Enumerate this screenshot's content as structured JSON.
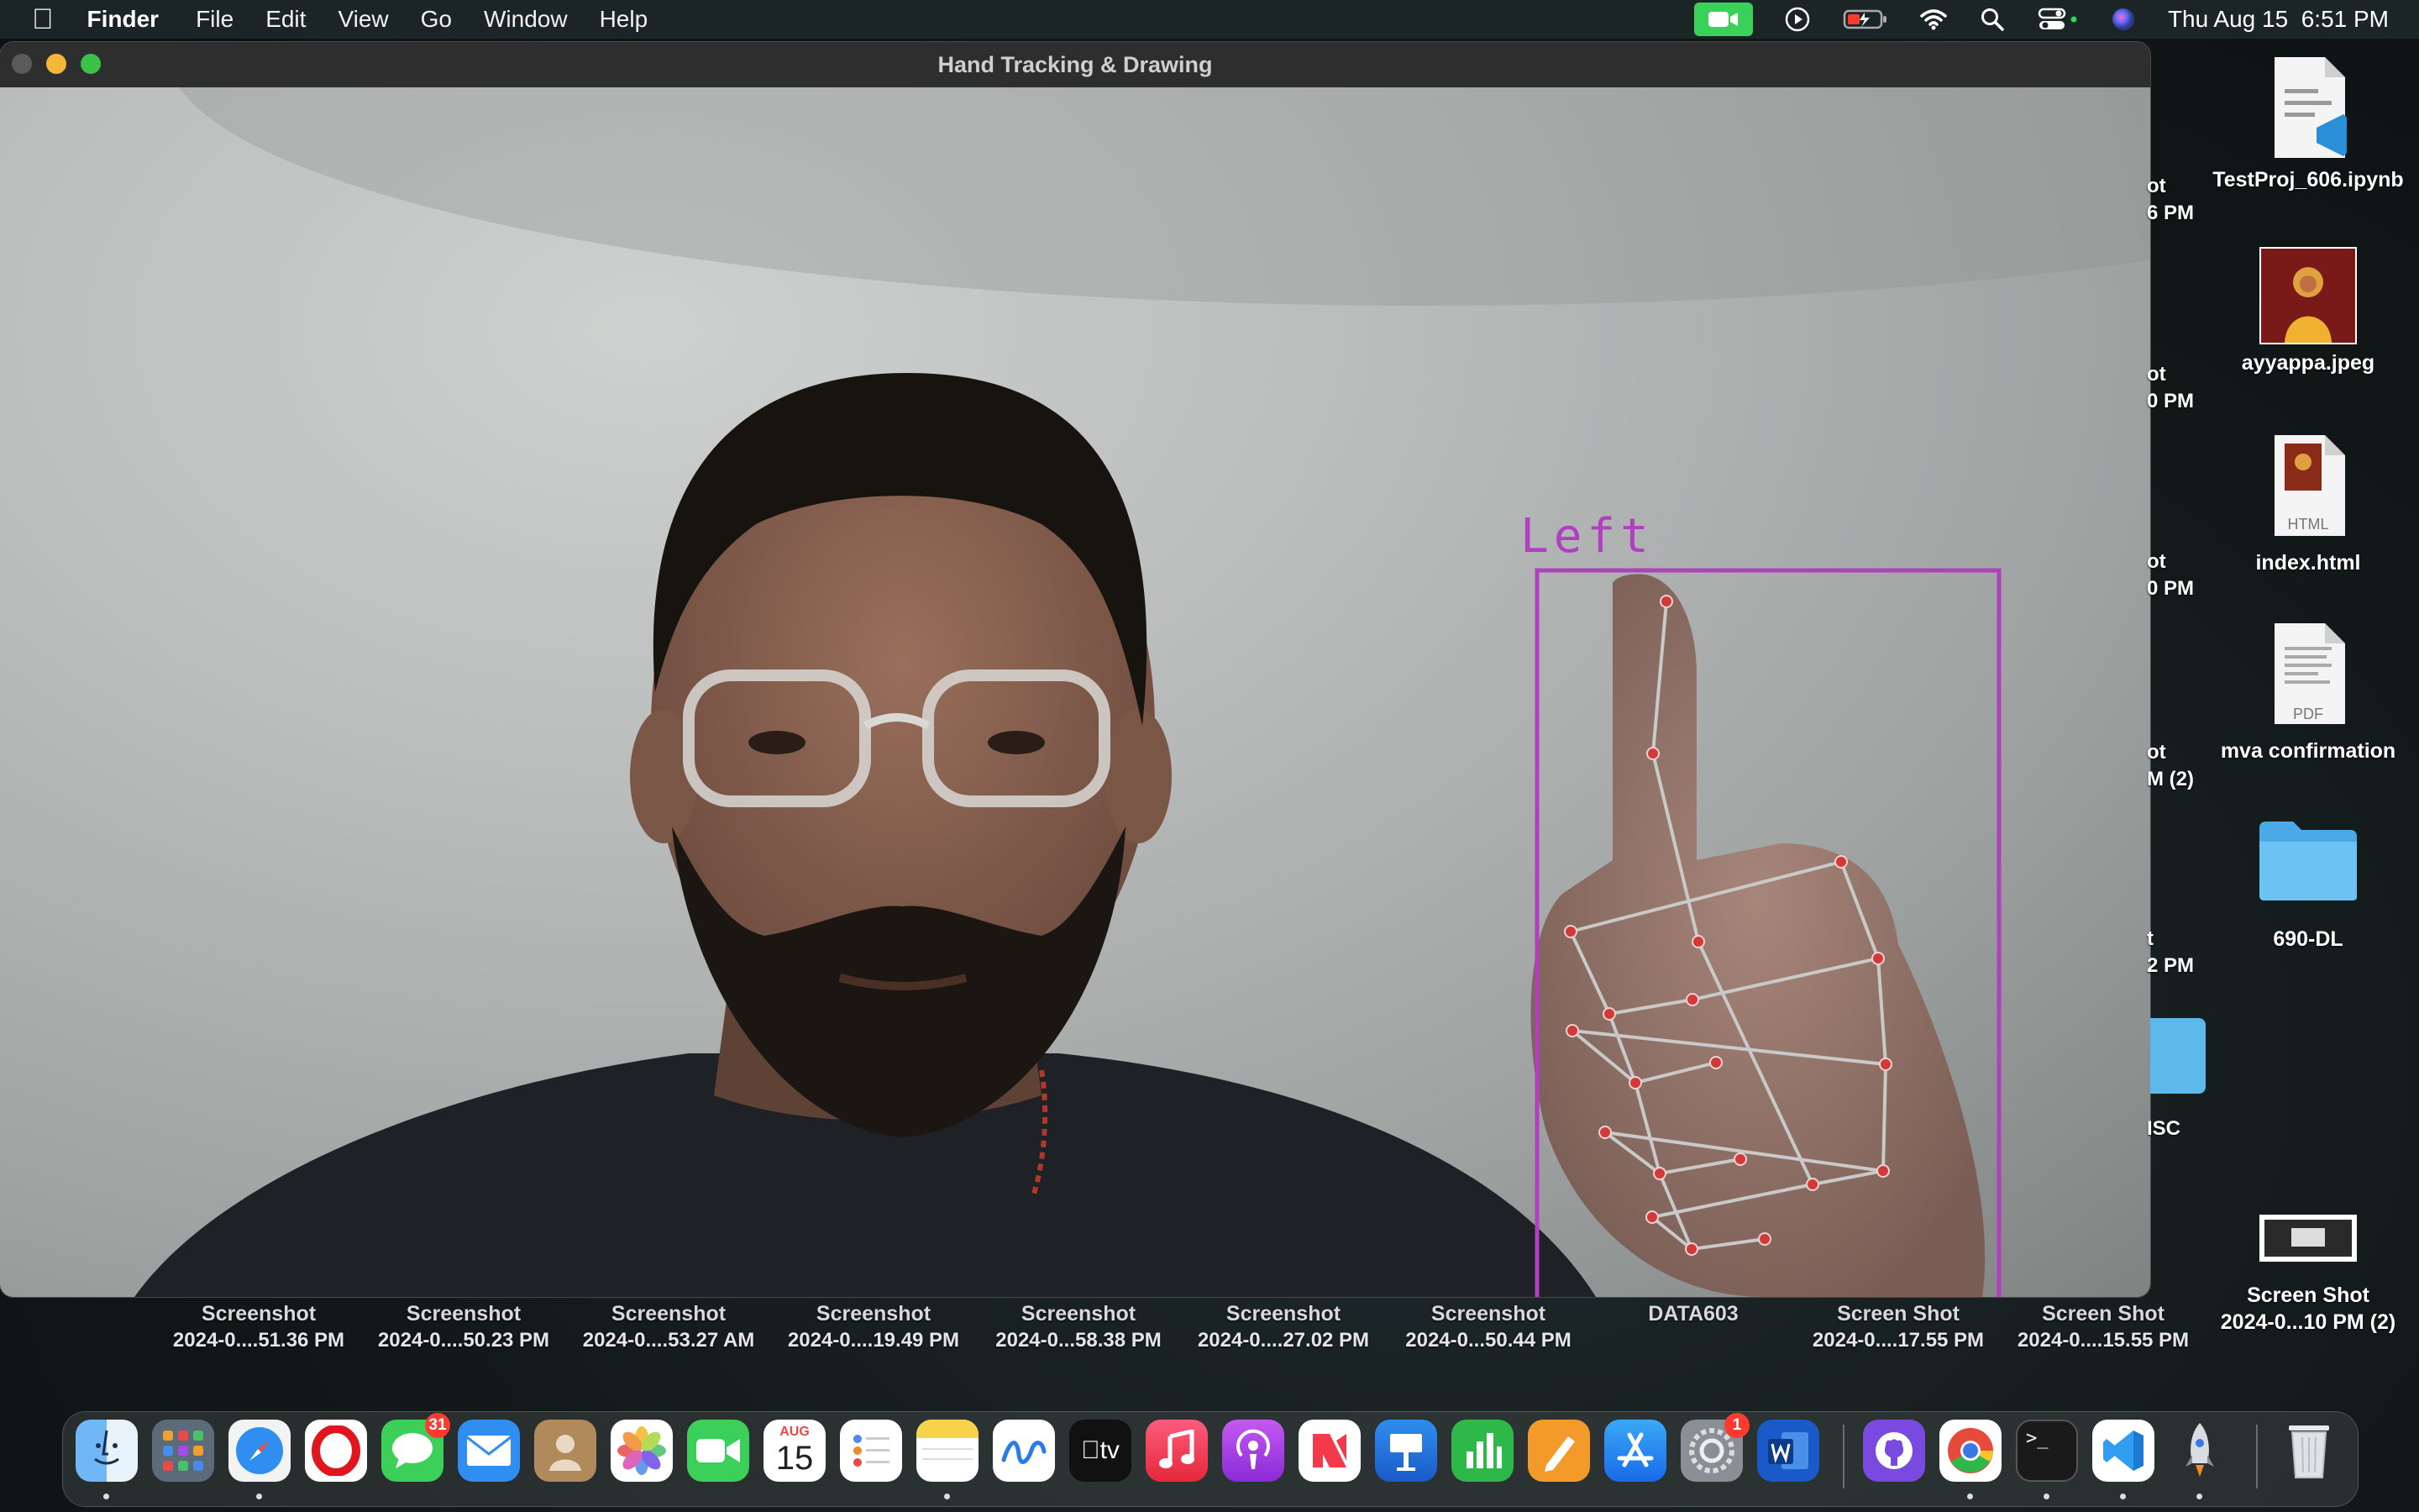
{
  "menubar": {
    "app_name": "Finder",
    "menus": [
      "File",
      "Edit",
      "View",
      "Go",
      "Window",
      "Help"
    ],
    "clock": "Thu Aug 15  6:51 PM"
  },
  "window": {
    "title": "Hand Tracking & Drawing",
    "hand_label": "Left",
    "overlay_color": "#b040c0"
  },
  "desktop_icons": [
    {
      "label": "TestProj_606.ipynb",
      "icon": "vscode-notebook-file-icon"
    },
    {
      "label": "ayyappa.jpeg",
      "icon": "image-file-icon"
    },
    {
      "label": "index.html",
      "icon": "html-file-icon",
      "badge": "HTML"
    },
    {
      "label": "mva confirmation",
      "icon": "pdf-file-icon",
      "badge": "PDF"
    },
    {
      "label": "690-DL",
      "icon": "folder-icon"
    },
    {
      "label": "Screen Shot",
      "label2": "2024-0...10 PM (2)",
      "icon": "screenshot-file-icon"
    }
  ],
  "partial_edge_labels": [
    "ot",
    "6 PM",
    "ot",
    "0 PM",
    "ot",
    "0 PM",
    "ot",
    "M (2)",
    "t",
    "2 PM",
    "ISC"
  ],
  "bottom_labels": [
    {
      "line1": "Screenshot",
      "line2": "2024-0....51.36 PM"
    },
    {
      "line1": "Screenshot",
      "line2": "2024-0....50.23 PM"
    },
    {
      "line1": "Screenshot",
      "line2": "2024-0....53.27 AM"
    },
    {
      "line1": "Screenshot",
      "line2": "2024-0....19.49 PM"
    },
    {
      "line1": "Screenshot",
      "line2": "2024-0...58.38 PM"
    },
    {
      "line1": "Screenshot",
      "line2": "2024-0....27.02 PM"
    },
    {
      "line1": "Screenshot",
      "line2": "2024-0...50.44 PM"
    },
    {
      "line1": "DATA603",
      "line2": ""
    },
    {
      "line1": "Screen Shot",
      "line2": "2024-0....17.55 PM"
    },
    {
      "line1": "Screen Shot",
      "line2": "2024-0....15.55 PM"
    }
  ],
  "dock": {
    "apps": [
      "Finder",
      "Launchpad",
      "Safari",
      "Opera",
      "Messages",
      "Mail",
      "Contacts",
      "Photos",
      "FaceTime",
      "Calendar",
      "Reminders",
      "Notes",
      "Freeform",
      "TV",
      "Music",
      "Podcasts",
      "News",
      "Keynote",
      "Numbers",
      "Pages",
      "App Store",
      "System Settings",
      "Microsoft Word",
      "GitHub Desktop",
      "Google Chrome",
      "Terminal",
      "Visual Studio Code",
      "Rocket",
      "Trash"
    ],
    "messages_badge": "31",
    "settings_badge": "1",
    "calendar_month": "AUG",
    "calendar_day": "15",
    "tv_label": "tv"
  }
}
